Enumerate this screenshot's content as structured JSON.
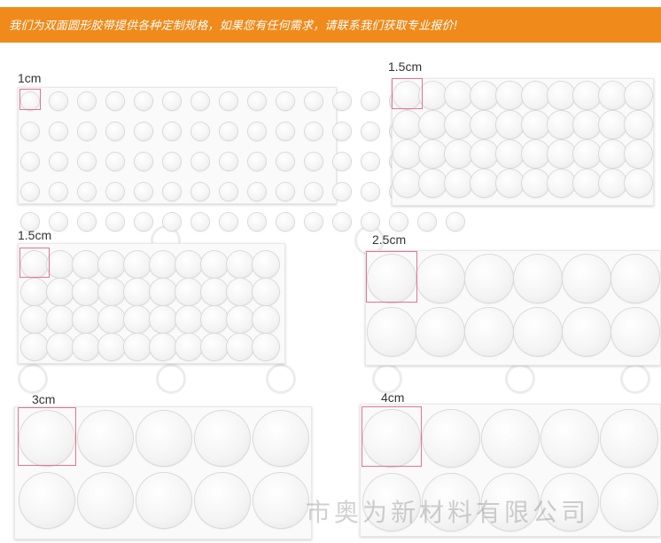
{
  "banner": {
    "text": "我们为双面圆形胶带提供各种定制规格，如果您有任何需求，请联系我们获取专业报价!",
    "color": "#f08a1a"
  },
  "products": [
    {
      "size_label": "1cm",
      "rows": 5,
      "cols": 16
    },
    {
      "size_label": "1.5cm",
      "rows": 4,
      "cols": 10
    },
    {
      "size_label": "1.5cm",
      "rows": 4,
      "cols": 10
    },
    {
      "size_label": "2.5cm",
      "rows": 2,
      "cols": 6
    },
    {
      "size_label": "3cm",
      "rows": 2,
      "cols": 5
    },
    {
      "size_label": "4cm",
      "rows": 2,
      "cols": 5
    }
  ],
  "watermark": {
    "text": "市奥为新材料有限公司",
    "icon": "company-logo-icon"
  },
  "marker_color": "#e57390"
}
